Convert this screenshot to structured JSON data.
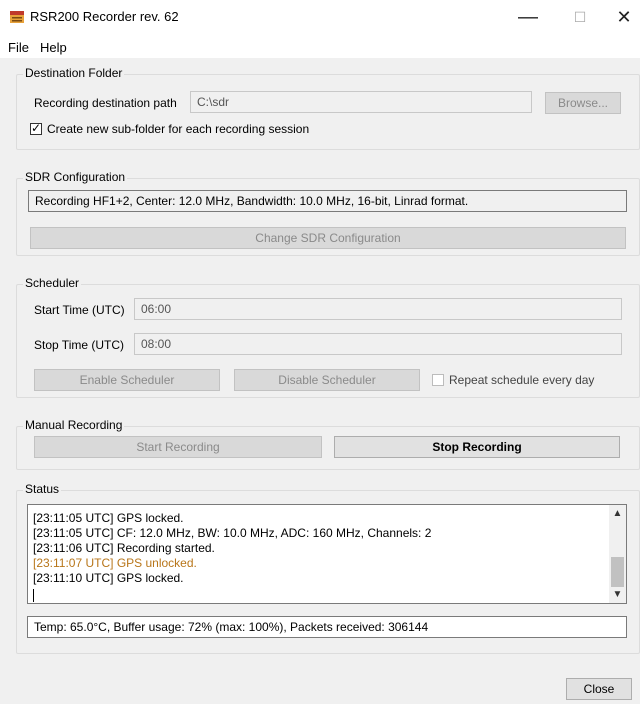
{
  "window": {
    "title": "RSR200 Recorder rev. 62",
    "minimize_glyph": "—",
    "maximize_glyph": "☐",
    "close_glyph": "✕",
    "icon": "app-icon"
  },
  "menu": [
    "File",
    "Help"
  ],
  "destination": {
    "group_title": "Destination Folder",
    "path_label": "Recording destination path",
    "path_value": "C:\\sdr",
    "browse_label": "Browse...",
    "subfolder_label": "Create new sub-folder for each recording session",
    "subfolder_checked": true
  },
  "sdr": {
    "group_title": "SDR Configuration",
    "config_text": "Recording HF1+2, Center: 12.0 MHz, Bandwidth: 10.0 MHz, 16-bit, Linrad format.",
    "change_label": "Change SDR Configuration"
  },
  "scheduler": {
    "group_title": "Scheduler",
    "start_label": "Start Time (UTC)",
    "start_value": "06:00",
    "stop_label": "Stop Time (UTC)",
    "stop_value": "08:00",
    "enable_label": "Enable Scheduler",
    "disable_label": "Disable Scheduler",
    "repeat_label": "Repeat schedule every day",
    "repeat_checked": false
  },
  "manual": {
    "group_title": "Manual Recording",
    "start_label": "Start Recording",
    "stop_label": "Stop Recording"
  },
  "status": {
    "group_title": "Status",
    "log": [
      {
        "text": "[23:11:05 UTC] GPS locked.",
        "color": "#000000"
      },
      {
        "text": "[23:11:05 UTC] CF: 12.0 MHz, BW: 10.0 MHz, ADC: 160 MHz, Channels: 2",
        "color": "#000000"
      },
      {
        "text": "[23:11:06 UTC] Recording started.",
        "color": "#000000"
      },
      {
        "text": "[23:11:07 UTC] GPS unlocked.",
        "color": "#b8761a"
      },
      {
        "text": "[23:11:10 UTC] GPS locked.",
        "color": "#000000"
      }
    ],
    "stats": "Temp: 65.0°C, Buffer usage: 72% (max: 100%), Packets received: 306144"
  },
  "close_button_label": "Close"
}
